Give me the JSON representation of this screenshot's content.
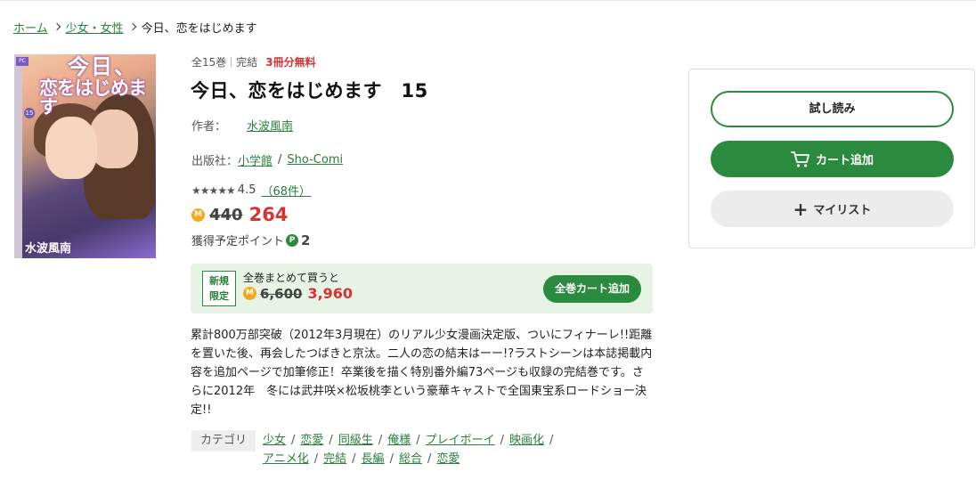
{
  "breadcrumb": {
    "home": "ホーム",
    "category": "少女・女性",
    "current": "今日、恋をはじめます"
  },
  "cover": {
    "title_line1": "今日、",
    "title_line2": "恋をはじめます",
    "volume": "15",
    "author": "水波風南"
  },
  "meta": {
    "volumes": "全15巻",
    "status": "完結",
    "free": "3冊分無料"
  },
  "title": "今日、恋をはじめます　15",
  "author": {
    "label": "作者：",
    "name": "水波風南"
  },
  "publisher": {
    "label": "出版社：",
    "name": "小学館",
    "label_name": "Sho-Comi"
  },
  "rating": {
    "stars": "★★★★★",
    "score": "4.5",
    "count": "（68件）"
  },
  "price": {
    "coin": "M",
    "original": "440",
    "sale": "264"
  },
  "points": {
    "label": "獲得予定ポイント",
    "coin": "P",
    "value": "2"
  },
  "bundle": {
    "badge_line1": "新規",
    "badge_line2": "限定",
    "text": "全巻まとめて買うと",
    "coin": "M",
    "original": "6,600",
    "sale": "3,960",
    "button": "全巻カート追加"
  },
  "description": "累計800万部突破（2012年3月現在）のリアル少女漫画決定版、ついにフィナーレ!!距離を置いた後、再会したつばきと京汰。二人の恋の結末はーー!?ラストシーンは本誌掲載内容を追加ページで加筆修正！卒業後を描く特別番外編73ページも収録の完結巻です。さらに2012年　冬には武井咲×松坂桃李という豪華キャストで全国東宝系ロードショー決定!!",
  "categories": {
    "label": "カテゴリ",
    "items": [
      "少女",
      "恋愛",
      "同級生",
      "俺様",
      "プレイボーイ",
      "映画化",
      "アニメ化",
      "完結",
      "長編",
      "総合",
      "恋愛"
    ]
  },
  "actions": {
    "trial": "試し読み",
    "cart": "カート追加",
    "mylist": "マイリスト"
  },
  "colors": {
    "accent": "#2a8a3e",
    "price_red": "#d63333",
    "coin": "#f3a91d",
    "bundle_bg": "#e7f4e5"
  }
}
